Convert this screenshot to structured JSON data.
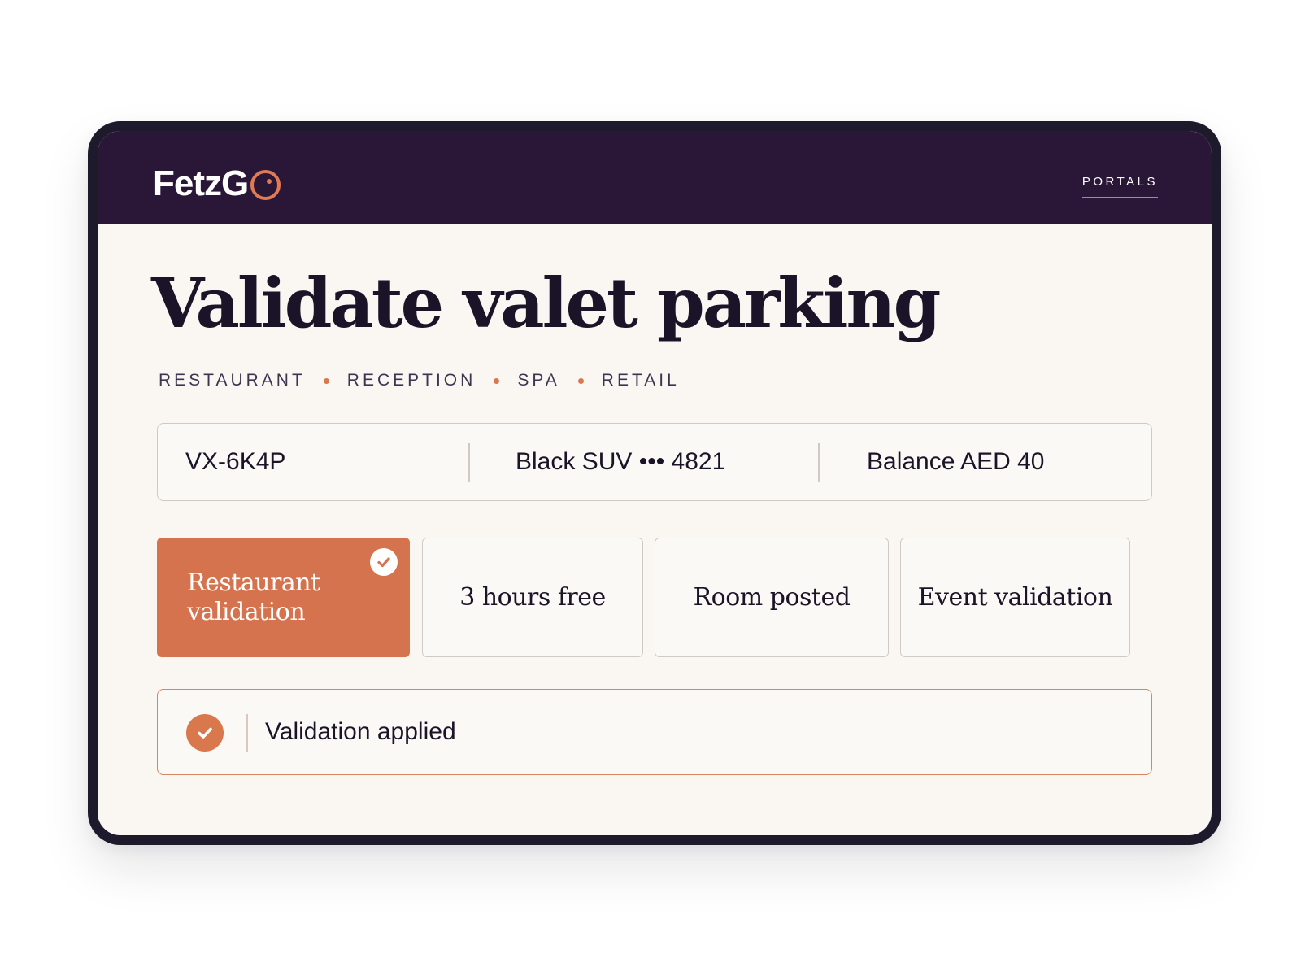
{
  "header": {
    "logo_text": "FetzG",
    "nav_label": "PORTALS"
  },
  "page": {
    "title": "Validate valet parking",
    "departments": [
      "RESTAURANT",
      "RECEPTION",
      "SPA",
      "RETAIL"
    ]
  },
  "ticket": {
    "code": "VX-6K4P",
    "vehicle": "Black SUV ••• 4821",
    "balance": "Balance AED 40"
  },
  "options": [
    {
      "label_line1": "Restaurant",
      "label_line2": "validation",
      "selected": true
    },
    {
      "label": "3 hours free",
      "selected": false
    },
    {
      "label": "Room posted",
      "selected": false
    },
    {
      "label": "Event validation",
      "selected": false
    }
  ],
  "status": {
    "message": "Validation applied"
  },
  "colors": {
    "header_bg": "#2a1738",
    "accent": "#d5734e",
    "page_bg": "#faf7f2",
    "text": "#1b1428"
  },
  "icons": {
    "logo_o": "ring-o-icon",
    "option_check": "check-circle-icon",
    "status_check": "check-circle-icon"
  }
}
